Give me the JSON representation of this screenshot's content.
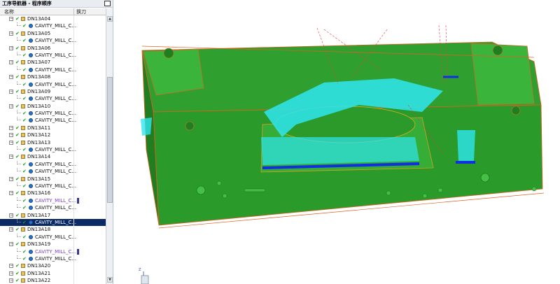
{
  "navigator": {
    "title": "工序导航器 - 程序顺序",
    "col_name": "名称",
    "col_tool_change": "换刀"
  },
  "rows": [
    {
      "type": "group",
      "label": "DN13A04"
    },
    {
      "type": "op",
      "label": "CAVITY_MILL_C..."
    },
    {
      "type": "group",
      "label": "DN13A05"
    },
    {
      "type": "op",
      "label": "CAVITY_MILL_C..."
    },
    {
      "type": "group",
      "label": "DN13A06"
    },
    {
      "type": "op",
      "label": "CAVITY_MILL_C..."
    },
    {
      "type": "group",
      "label": "DN13A07"
    },
    {
      "type": "op",
      "label": "CAVITY_MILL_C..."
    },
    {
      "type": "group",
      "label": "DN13A08"
    },
    {
      "type": "op",
      "label": "CAVITY_MILL_C..."
    },
    {
      "type": "group",
      "label": "DN13A09"
    },
    {
      "type": "op",
      "label": "CAVITY_MILL_C..."
    },
    {
      "type": "group",
      "label": "DN13A10"
    },
    {
      "type": "op",
      "label": "CAVITY_MILL_C..."
    },
    {
      "type": "op",
      "label": "CAVITY_MILL_C..."
    },
    {
      "type": "group",
      "label": "DN13A11"
    },
    {
      "type": "group",
      "label": "DN13A12"
    },
    {
      "type": "group",
      "label": "DN13A13"
    },
    {
      "type": "op",
      "label": "CAVITY_MILL_C..."
    },
    {
      "type": "group",
      "label": "DN13A14"
    },
    {
      "type": "op",
      "label": "CAVITY_MILL_C..."
    },
    {
      "type": "op",
      "label": "CAVITY_MILL_C..."
    },
    {
      "type": "group",
      "label": "DN13A15"
    },
    {
      "type": "op",
      "label": "CAVITY_MILL_C..."
    },
    {
      "type": "group",
      "label": "DN13A16"
    },
    {
      "type": "op",
      "label": "CAVITY_MILL_C...",
      "purple": true,
      "tool_mark": true
    },
    {
      "type": "op",
      "label": "CAVITY_MILL_C..."
    },
    {
      "type": "group",
      "label": "DN13A17"
    },
    {
      "type": "op",
      "label": "CAVITY_MILL_C...",
      "selected": true
    },
    {
      "type": "group",
      "label": "DN13A18"
    },
    {
      "type": "op",
      "label": "CAVITY_MILL_C..."
    },
    {
      "type": "group",
      "label": "DN13A19"
    },
    {
      "type": "op",
      "label": "CAVITY_MILL_C...",
      "purple": true,
      "tool_mark": true
    },
    {
      "type": "op",
      "label": "CAVITY_MILL_C..."
    },
    {
      "type": "group",
      "label": "DN13A20"
    },
    {
      "type": "group",
      "label": "DN13A21"
    },
    {
      "type": "group",
      "label": "DN13A22"
    }
  ],
  "colors": {
    "part_green": "#2fa02f",
    "toolpath_cyan": "#2ee6f0",
    "toolpath_blue": "#1030e0",
    "outline_orange": "#e06020",
    "selection_navy": "#0a2a66"
  },
  "triad": {
    "z_label": "Z"
  }
}
